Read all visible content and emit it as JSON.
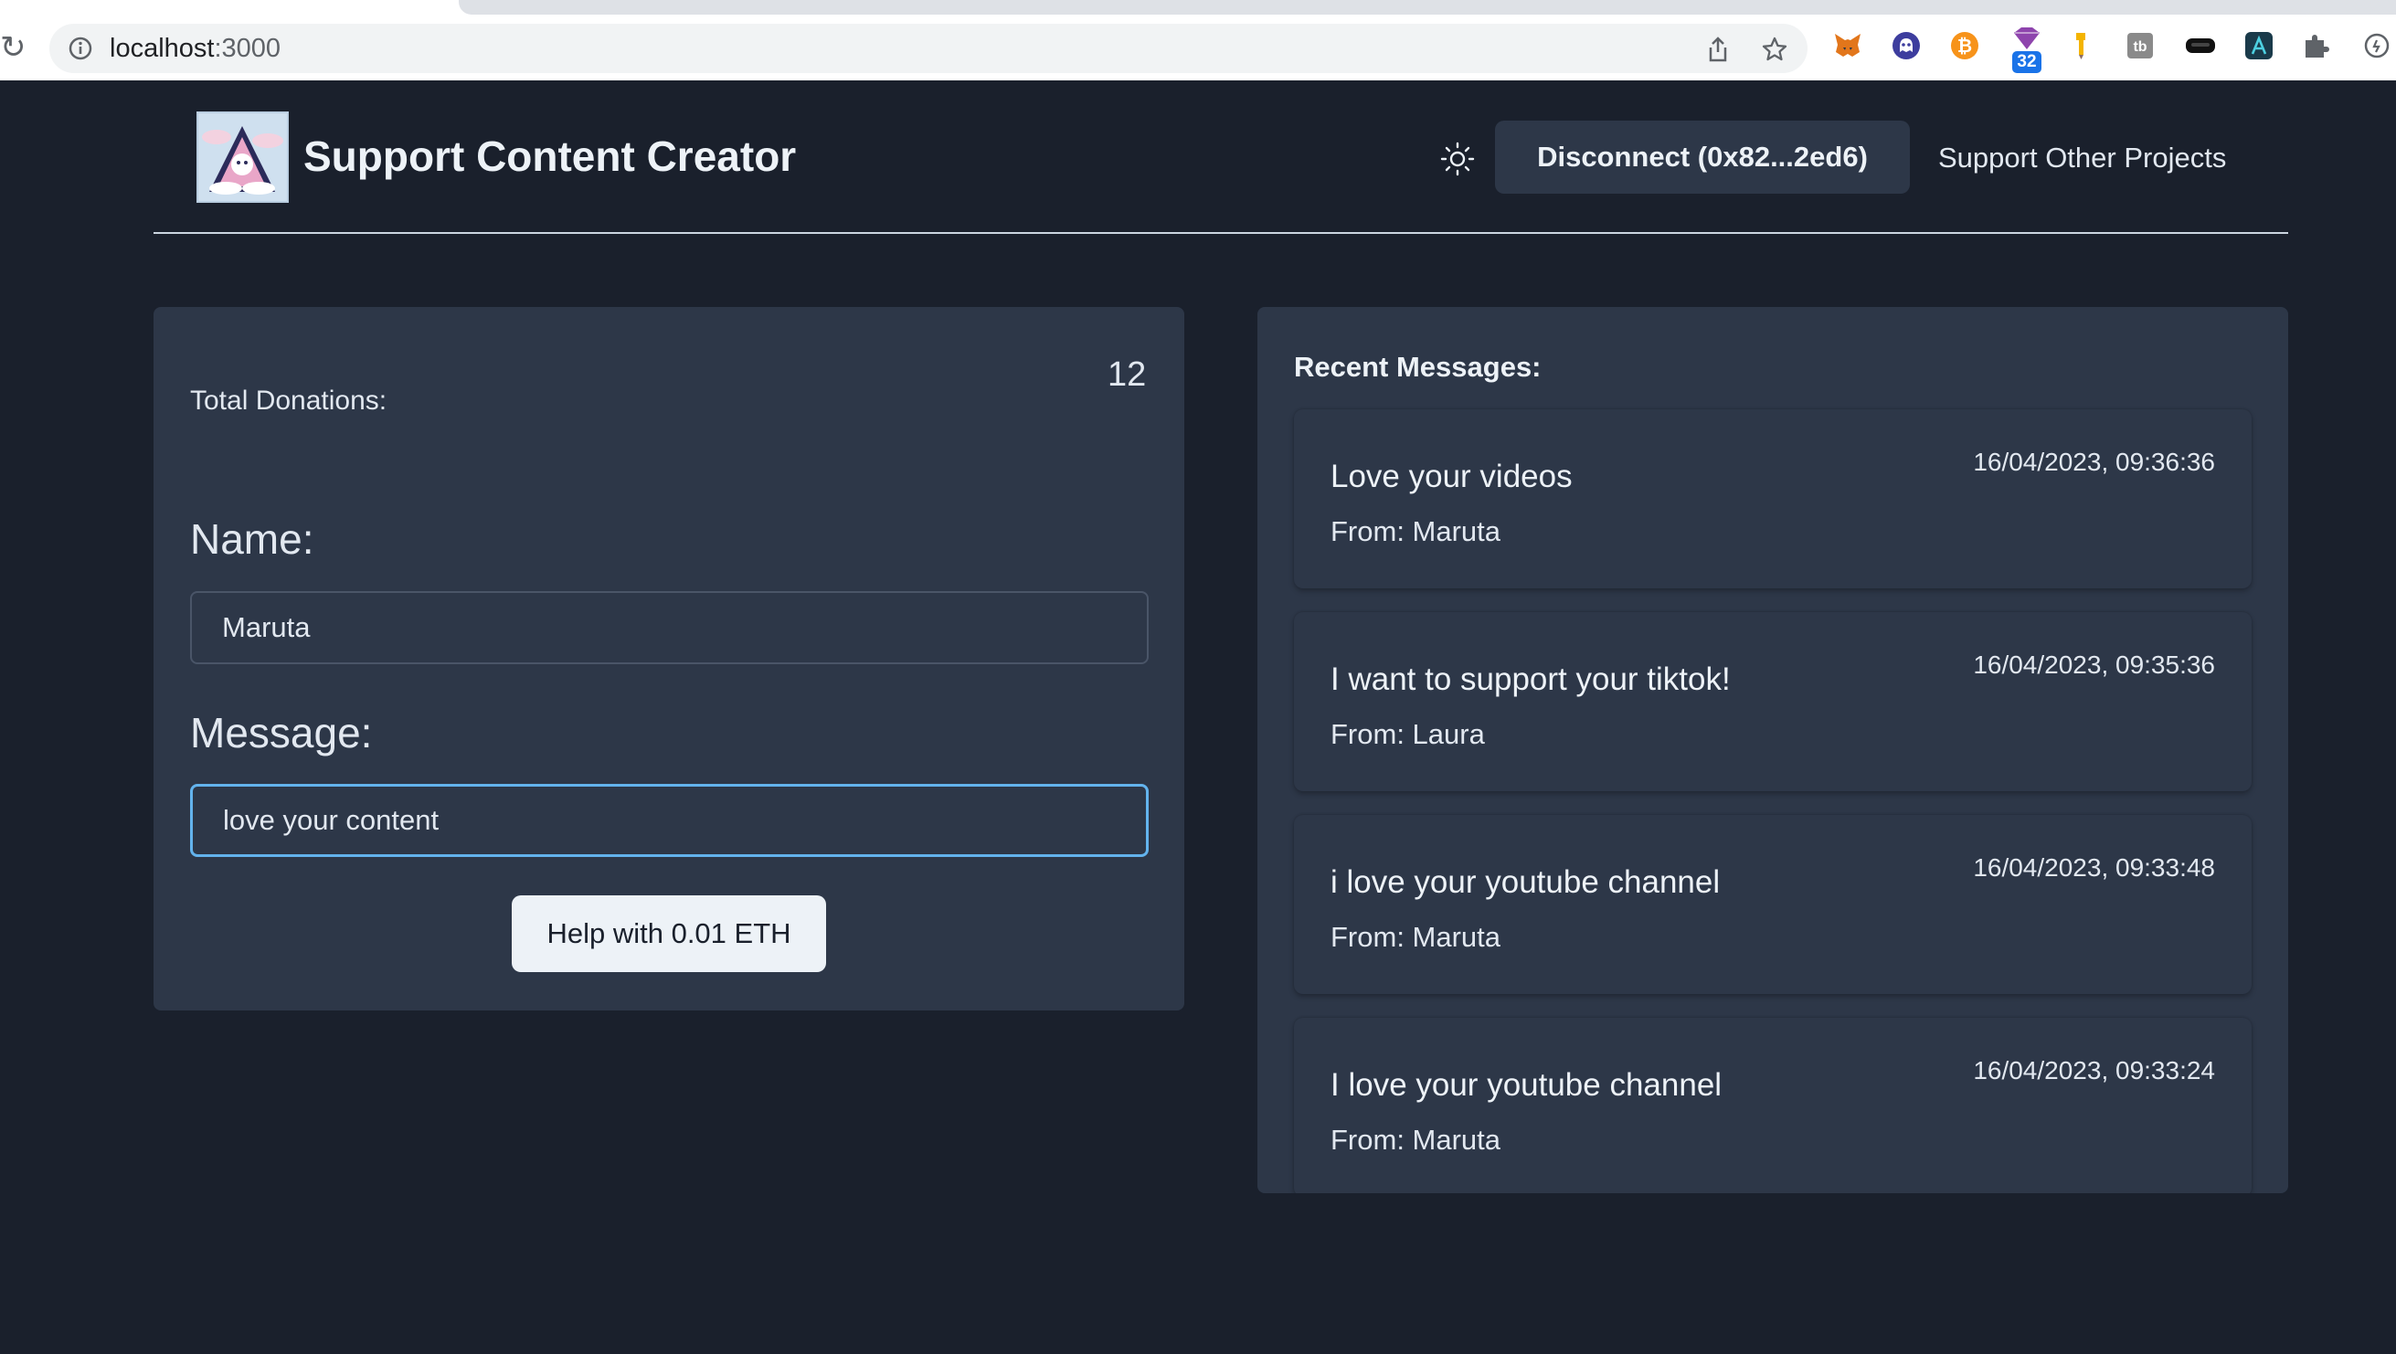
{
  "browser": {
    "url_host": "localhost",
    "url_port": ":3000",
    "extension_badge": "32",
    "extensions": [
      "metamask-fox-icon",
      "ghost-icon",
      "bitcoin-icon",
      "gem-icon",
      "pencil-icon",
      "tb-icon",
      "vr-headset-icon",
      "lambda-icon",
      "puzzle-icon",
      "refresh-circle-icon"
    ]
  },
  "header": {
    "title": "Support Content Creator",
    "disconnect_label": "Disconnect (0x82...2ed6)",
    "support_link": "Support Other Projects"
  },
  "donation": {
    "total_label": "Total Donations:",
    "total_value": "12",
    "name_label": "Name:",
    "name_value": "Maruta",
    "message_label": "Message:",
    "message_value": "love your content",
    "submit_label": "Help with 0.01 ETH"
  },
  "recent": {
    "title": "Recent Messages:",
    "messages": [
      {
        "text": "Love your videos",
        "from": "From: Maruta",
        "time": "16/04/2023, 09:36:36"
      },
      {
        "text": "I want to support your tiktok!",
        "from": "From: Laura",
        "time": "16/04/2023, 09:35:36"
      },
      {
        "text": "i love your youtube channel",
        "from": "From: Maruta",
        "time": "16/04/2023, 09:33:48"
      },
      {
        "text": "I love your youtube channel",
        "from": "From: Maruta",
        "time": "16/04/2023, 09:33:24"
      }
    ]
  },
  "colors": {
    "page_bg": "#1a202c",
    "card_bg": "#2d3748",
    "focus_ring": "#63b3ed",
    "button_light": "#edf2f7"
  }
}
